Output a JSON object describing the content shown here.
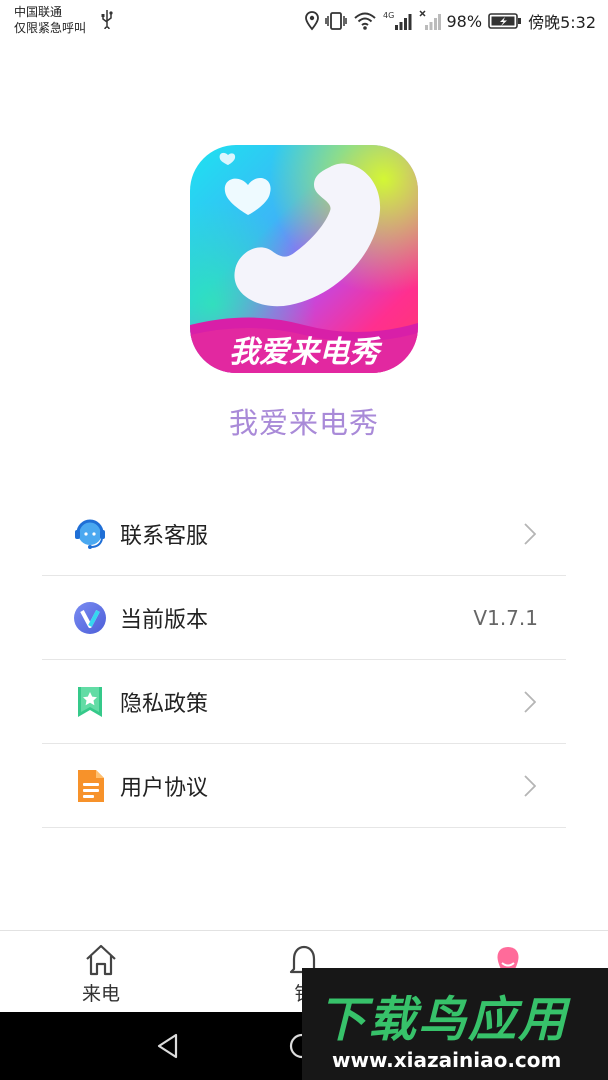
{
  "status_bar": {
    "carrier_line1": "中国联通",
    "carrier_line2": "仅限紧急呼叫",
    "battery": "98%",
    "time": "傍晚5:32",
    "icons": [
      "usb-icon",
      "location-icon",
      "vibrate-icon",
      "wifi-icon",
      "signal-4g-icon",
      "signal-empty-icon",
      "battery-charging-icon"
    ],
    "network_badge": "4G"
  },
  "app": {
    "logo_text": "我爱来电秀",
    "name": "我爱来电秀"
  },
  "menu": {
    "items": [
      {
        "label": "联系客服",
        "icon": "customer-service-icon",
        "value": "",
        "has_chevron": true
      },
      {
        "label": "当前版本",
        "icon": "version-v-icon",
        "value": "V1.7.1",
        "has_chevron": false
      },
      {
        "label": "隐私政策",
        "icon": "bookmark-star-icon",
        "value": "",
        "has_chevron": true
      },
      {
        "label": "用户协议",
        "icon": "document-icon",
        "value": "",
        "has_chevron": true
      }
    ]
  },
  "bottom_nav": {
    "items": [
      {
        "label": "来电",
        "icon": "home-icon"
      },
      {
        "label": "铃",
        "icon": "bell-icon"
      },
      {
        "label": "",
        "icon": "profile-icon"
      }
    ]
  },
  "system_nav": {
    "icons": [
      "back-icon",
      "home-circle-icon"
    ]
  },
  "watermark": {
    "title": "下载鸟应用",
    "url": "www.xiazainiao.com"
  },
  "colors": {
    "app_name": "#a98ad8",
    "divider": "#e6e6e6",
    "watermark_green": "#37c26a"
  }
}
